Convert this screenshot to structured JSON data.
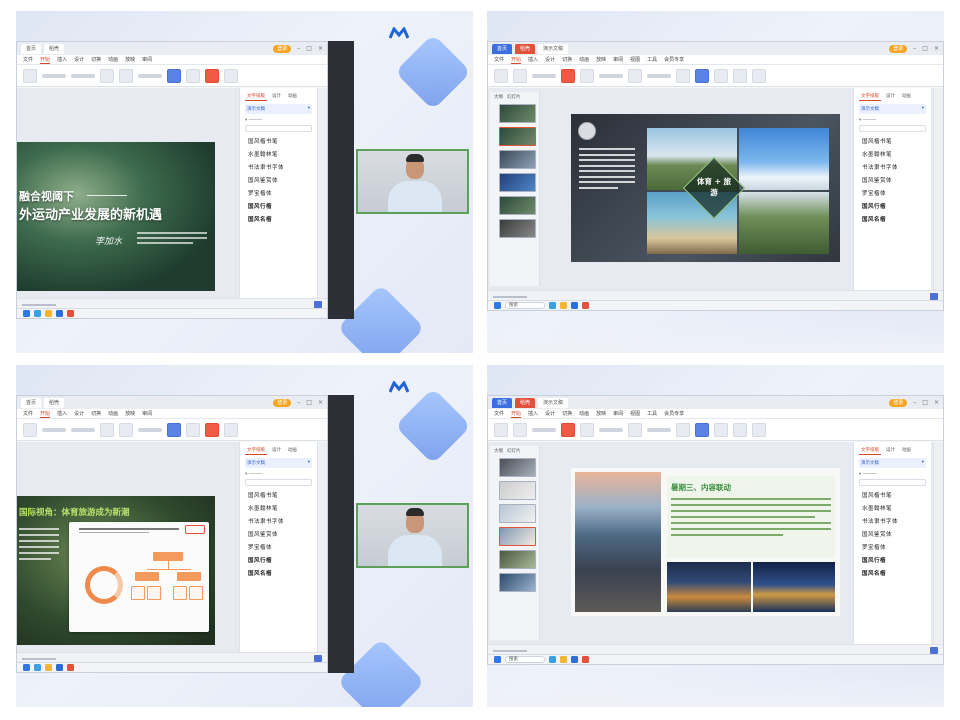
{
  "panels": {
    "p1": {
      "slide_title_line1": "融合视阈下",
      "slide_title_line2": "外运动产业发展的新机遇",
      "signature": "李加水"
    },
    "p2": {
      "center_label": "体育 + 旅游"
    },
    "p3": {
      "slide_title": "国际视角：体育旅游成为新潮"
    },
    "p4": {
      "slide_title": "暑期三、内容联动"
    }
  },
  "wps": {
    "tabs": [
      "首页",
      "稻壳",
      "演示文稿"
    ],
    "login": "登录",
    "menu": [
      "文件",
      "开始",
      "插入",
      "设计",
      "切换",
      "动画",
      "放映",
      "审阅",
      "视图",
      "工具",
      "会员专享"
    ],
    "sidepane": {
      "tabs": [
        "文字排版",
        "设计",
        "动画"
      ],
      "active_item": "演示文稿",
      "items": [
        "国风楷书笔",
        "水墨翰林笔",
        "书法隶书字体",
        "国风鉴赏体",
        "罗宝楷体",
        "国风行楷",
        "国风名楷"
      ]
    },
    "thumbs_tabs": [
      "大纲",
      "幻灯片"
    ],
    "taskbar_search": "搜索"
  }
}
